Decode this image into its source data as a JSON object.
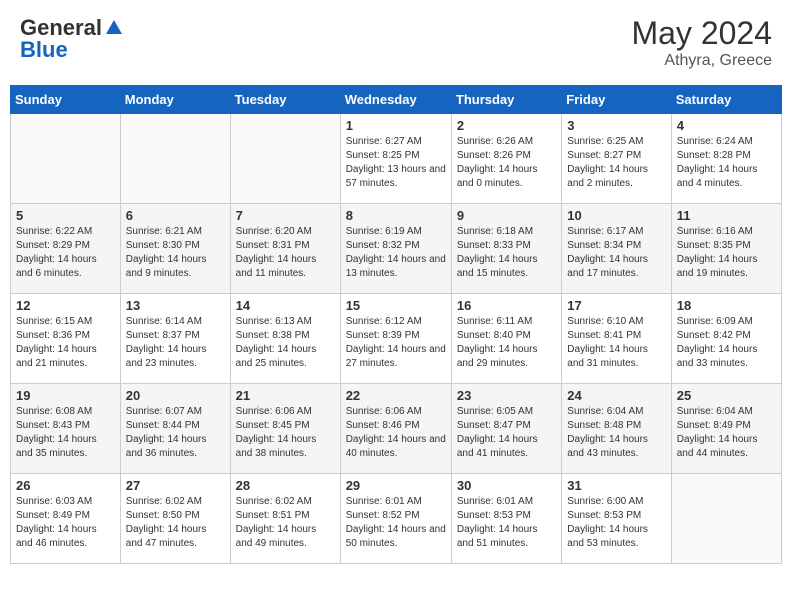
{
  "header": {
    "logo_general": "General",
    "logo_blue": "Blue",
    "month_year": "May 2024",
    "location": "Athyra, Greece"
  },
  "days_of_week": [
    "Sunday",
    "Monday",
    "Tuesday",
    "Wednesday",
    "Thursday",
    "Friday",
    "Saturday"
  ],
  "weeks": [
    [
      {
        "day": "",
        "info": ""
      },
      {
        "day": "",
        "info": ""
      },
      {
        "day": "",
        "info": ""
      },
      {
        "day": "1",
        "sunrise": "Sunrise: 6:27 AM",
        "sunset": "Sunset: 8:25 PM",
        "daylight": "Daylight: 13 hours and 57 minutes."
      },
      {
        "day": "2",
        "sunrise": "Sunrise: 6:26 AM",
        "sunset": "Sunset: 8:26 PM",
        "daylight": "Daylight: 14 hours and 0 minutes."
      },
      {
        "day": "3",
        "sunrise": "Sunrise: 6:25 AM",
        "sunset": "Sunset: 8:27 PM",
        "daylight": "Daylight: 14 hours and 2 minutes."
      },
      {
        "day": "4",
        "sunrise": "Sunrise: 6:24 AM",
        "sunset": "Sunset: 8:28 PM",
        "daylight": "Daylight: 14 hours and 4 minutes."
      }
    ],
    [
      {
        "day": "5",
        "sunrise": "Sunrise: 6:22 AM",
        "sunset": "Sunset: 8:29 PM",
        "daylight": "Daylight: 14 hours and 6 minutes."
      },
      {
        "day": "6",
        "sunrise": "Sunrise: 6:21 AM",
        "sunset": "Sunset: 8:30 PM",
        "daylight": "Daylight: 14 hours and 9 minutes."
      },
      {
        "day": "7",
        "sunrise": "Sunrise: 6:20 AM",
        "sunset": "Sunset: 8:31 PM",
        "daylight": "Daylight: 14 hours and 11 minutes."
      },
      {
        "day": "8",
        "sunrise": "Sunrise: 6:19 AM",
        "sunset": "Sunset: 8:32 PM",
        "daylight": "Daylight: 14 hours and 13 minutes."
      },
      {
        "day": "9",
        "sunrise": "Sunrise: 6:18 AM",
        "sunset": "Sunset: 8:33 PM",
        "daylight": "Daylight: 14 hours and 15 minutes."
      },
      {
        "day": "10",
        "sunrise": "Sunrise: 6:17 AM",
        "sunset": "Sunset: 8:34 PM",
        "daylight": "Daylight: 14 hours and 17 minutes."
      },
      {
        "day": "11",
        "sunrise": "Sunrise: 6:16 AM",
        "sunset": "Sunset: 8:35 PM",
        "daylight": "Daylight: 14 hours and 19 minutes."
      }
    ],
    [
      {
        "day": "12",
        "sunrise": "Sunrise: 6:15 AM",
        "sunset": "Sunset: 8:36 PM",
        "daylight": "Daylight: 14 hours and 21 minutes."
      },
      {
        "day": "13",
        "sunrise": "Sunrise: 6:14 AM",
        "sunset": "Sunset: 8:37 PM",
        "daylight": "Daylight: 14 hours and 23 minutes."
      },
      {
        "day": "14",
        "sunrise": "Sunrise: 6:13 AM",
        "sunset": "Sunset: 8:38 PM",
        "daylight": "Daylight: 14 hours and 25 minutes."
      },
      {
        "day": "15",
        "sunrise": "Sunrise: 6:12 AM",
        "sunset": "Sunset: 8:39 PM",
        "daylight": "Daylight: 14 hours and 27 minutes."
      },
      {
        "day": "16",
        "sunrise": "Sunrise: 6:11 AM",
        "sunset": "Sunset: 8:40 PM",
        "daylight": "Daylight: 14 hours and 29 minutes."
      },
      {
        "day": "17",
        "sunrise": "Sunrise: 6:10 AM",
        "sunset": "Sunset: 8:41 PM",
        "daylight": "Daylight: 14 hours and 31 minutes."
      },
      {
        "day": "18",
        "sunrise": "Sunrise: 6:09 AM",
        "sunset": "Sunset: 8:42 PM",
        "daylight": "Daylight: 14 hours and 33 minutes."
      }
    ],
    [
      {
        "day": "19",
        "sunrise": "Sunrise: 6:08 AM",
        "sunset": "Sunset: 8:43 PM",
        "daylight": "Daylight: 14 hours and 35 minutes."
      },
      {
        "day": "20",
        "sunrise": "Sunrise: 6:07 AM",
        "sunset": "Sunset: 8:44 PM",
        "daylight": "Daylight: 14 hours and 36 minutes."
      },
      {
        "day": "21",
        "sunrise": "Sunrise: 6:06 AM",
        "sunset": "Sunset: 8:45 PM",
        "daylight": "Daylight: 14 hours and 38 minutes."
      },
      {
        "day": "22",
        "sunrise": "Sunrise: 6:06 AM",
        "sunset": "Sunset: 8:46 PM",
        "daylight": "Daylight: 14 hours and 40 minutes."
      },
      {
        "day": "23",
        "sunrise": "Sunrise: 6:05 AM",
        "sunset": "Sunset: 8:47 PM",
        "daylight": "Daylight: 14 hours and 41 minutes."
      },
      {
        "day": "24",
        "sunrise": "Sunrise: 6:04 AM",
        "sunset": "Sunset: 8:48 PM",
        "daylight": "Daylight: 14 hours and 43 minutes."
      },
      {
        "day": "25",
        "sunrise": "Sunrise: 6:04 AM",
        "sunset": "Sunset: 8:49 PM",
        "daylight": "Daylight: 14 hours and 44 minutes."
      }
    ],
    [
      {
        "day": "26",
        "sunrise": "Sunrise: 6:03 AM",
        "sunset": "Sunset: 8:49 PM",
        "daylight": "Daylight: 14 hours and 46 minutes."
      },
      {
        "day": "27",
        "sunrise": "Sunrise: 6:02 AM",
        "sunset": "Sunset: 8:50 PM",
        "daylight": "Daylight: 14 hours and 47 minutes."
      },
      {
        "day": "28",
        "sunrise": "Sunrise: 6:02 AM",
        "sunset": "Sunset: 8:51 PM",
        "daylight": "Daylight: 14 hours and 49 minutes."
      },
      {
        "day": "29",
        "sunrise": "Sunrise: 6:01 AM",
        "sunset": "Sunset: 8:52 PM",
        "daylight": "Daylight: 14 hours and 50 minutes."
      },
      {
        "day": "30",
        "sunrise": "Sunrise: 6:01 AM",
        "sunset": "Sunset: 8:53 PM",
        "daylight": "Daylight: 14 hours and 51 minutes."
      },
      {
        "day": "31",
        "sunrise": "Sunrise: 6:00 AM",
        "sunset": "Sunset: 8:53 PM",
        "daylight": "Daylight: 14 hours and 53 minutes."
      },
      {
        "day": "",
        "info": ""
      }
    ]
  ]
}
